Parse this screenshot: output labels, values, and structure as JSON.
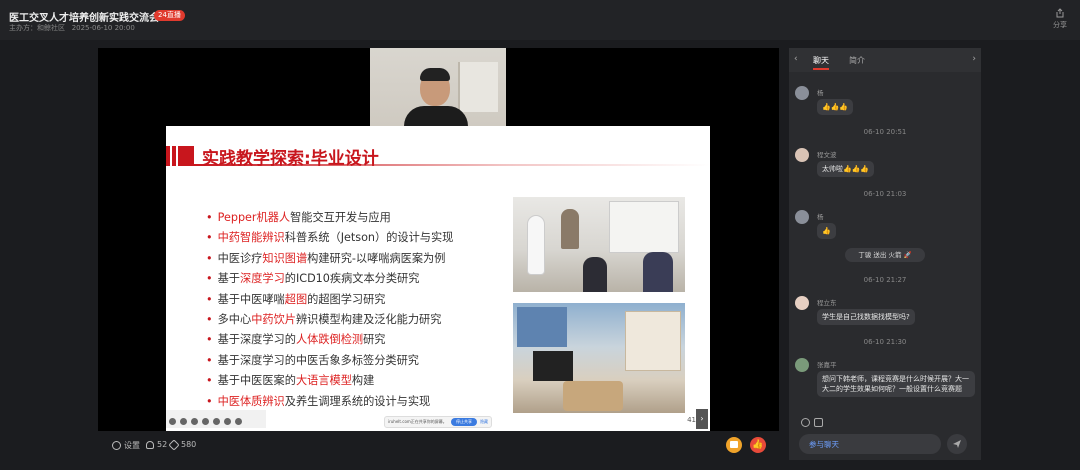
{
  "header": {
    "title": "医工交叉人才培养创新实践交流会",
    "live_badge": "24直播",
    "organizer": "主办方：和鲸社区",
    "datetime": "2025-06-10 20:00",
    "share_label": "分享"
  },
  "slide": {
    "title": "实践教学探索:毕业设计",
    "bullets": [
      {
        "pre": "",
        "hl": "Pepper机器人",
        "post": "智能交互开发与应用"
      },
      {
        "pre": "",
        "hl": "中药智能辨识",
        "post": "科普系统（Jetson）的设计与实现"
      },
      {
        "pre": "中医诊疗",
        "hl": "知识图谱",
        "post": "构建研究-以哮喘病医案为例"
      },
      {
        "pre": "基于",
        "hl": "深度学习",
        "post": "的ICD10疾病文本分类研究"
      },
      {
        "pre": "基于中医哮喘",
        "hl": "超图",
        "post": "的超图学习研究"
      },
      {
        "pre": "多中心",
        "hl": "中药饮片",
        "post": "辨识模型构建及泛化能力研究"
      },
      {
        "pre": "基于深度学习的",
        "hl": "人体跌倒检测",
        "post": "研究"
      },
      {
        "pre": "基于深度学习的中医舌象多标签分类研究",
        "hl": "",
        "post": ""
      },
      {
        "pre": "基于中医医案的",
        "hl": "大语言模型",
        "post": "构建"
      },
      {
        "pre": "",
        "hl": "中医体质辨识",
        "post": "及养生调理系统的设计与实现"
      }
    ],
    "share_tip": "iruhelt.com正在共享你的屏幕。",
    "share_tip_button": "停止共享",
    "share_tip_hide": "隐藏",
    "page_number": "41"
  },
  "controls": {
    "settings_label": "设置",
    "viewers": "52",
    "likes": "580"
  },
  "panel": {
    "tab_chat": "聊天",
    "tab_intro": "简介",
    "messages": [
      {
        "sender": "杨",
        "text": "👍👍👍"
      },
      {
        "time": "06-10 20:51"
      },
      {
        "sender": "程文波",
        "text": "太帅啦👍👍👍"
      },
      {
        "time": "06-10 21:03"
      },
      {
        "sender": "杨",
        "text": "👍"
      },
      {
        "gift": "丁骏 送出 火箭 🚀"
      },
      {
        "time": "06-10 21:27"
      },
      {
        "sender": "程立东",
        "text": "学生是自己找数据找模型吗?"
      },
      {
        "time": "06-10 21:30"
      },
      {
        "sender": "张嘉平",
        "text": "想问下韩老师，课程竞赛是什么时候开展？大一大二的学生效果如何呢？一般设置什么竞赛题"
      }
    ],
    "input_placeholder": "参与聊天"
  },
  "colors": {
    "accent_red": "#c8161d",
    "live_red": "#e03a2e",
    "link_blue": "#6fa0ff"
  }
}
